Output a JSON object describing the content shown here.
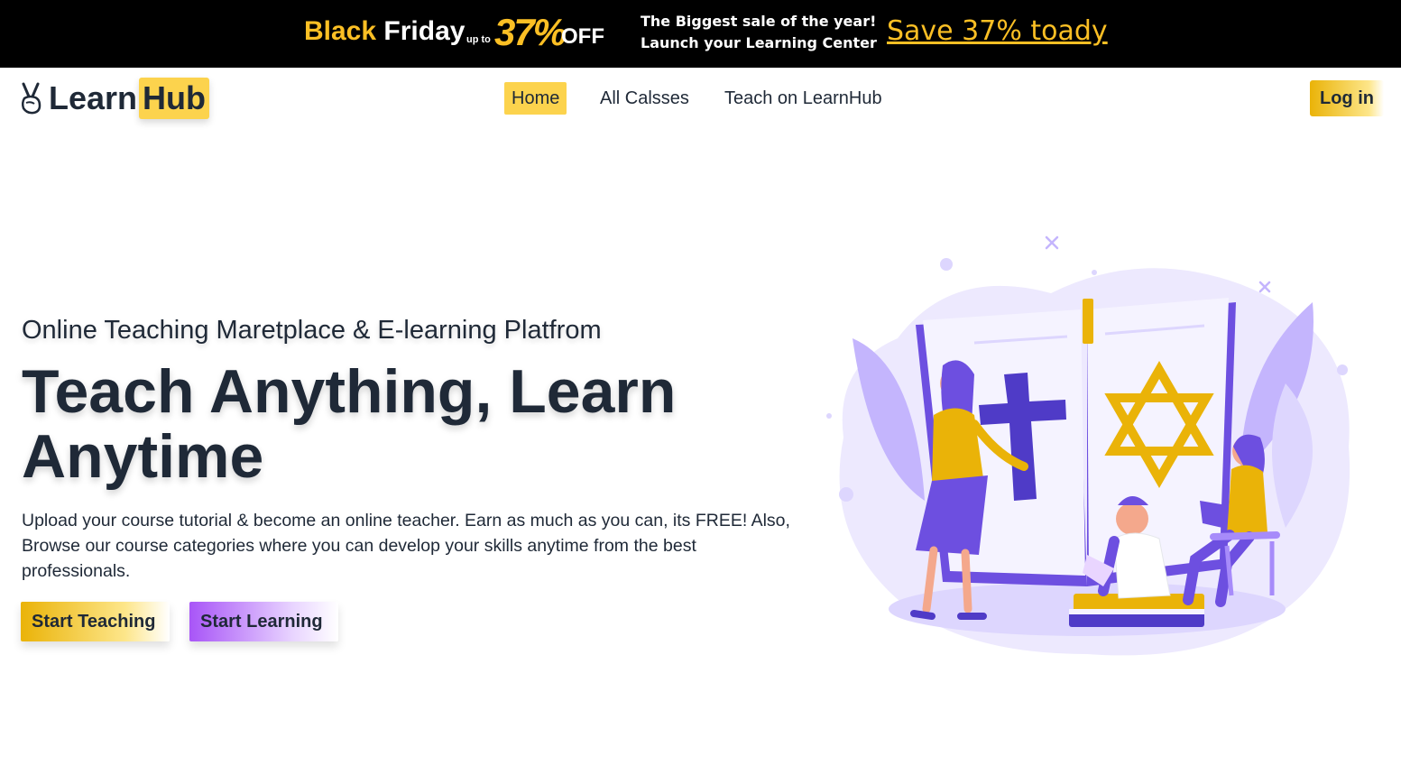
{
  "promo": {
    "black": "Black",
    "friday": "Friday",
    "upto": "up to",
    "percent": "37%",
    "off": "OFF",
    "line1": "The Biggest sale of the year!",
    "line2": "Launch your Learning Center",
    "save_link": "Save 37% toady"
  },
  "brand": {
    "learn": "Learn",
    "hub": "Hub",
    "icon": "victory-hand-icon"
  },
  "nav": {
    "home": "Home",
    "classes": "All Calsses",
    "teach": "Teach on LearnHub",
    "login": "Log in"
  },
  "hero": {
    "subtitle": "Online Teaching Maretplace & E-learning Platfrom",
    "title": "Teach Anything, Learn Anytime",
    "description": "Upload your course tutorial & become an online teacher. Earn as much as you can, its FREE! Also, Browse our course categories where you can develop your skills anytime from the best professionals.",
    "btn_teach": "Start Teaching",
    "btn_learn": "Start Learning"
  },
  "colors": {
    "accent_yellow": "#fcd34d",
    "accent_purple": "#a855f7",
    "promo_bg": "#000000",
    "text": "#1f2937"
  }
}
